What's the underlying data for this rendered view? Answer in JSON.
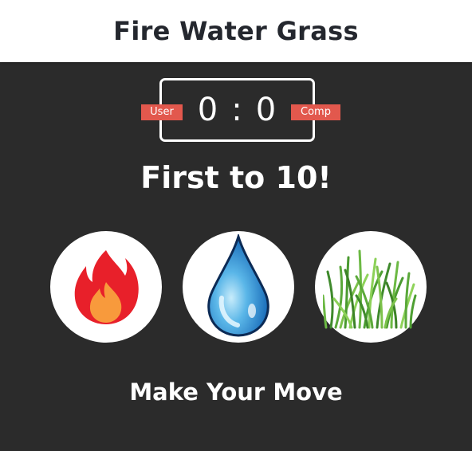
{
  "header": {
    "title": "Fire Water Grass"
  },
  "scoreboard": {
    "user_label": "User",
    "comp_label": "Comp",
    "user_score": "0",
    "separator": ":",
    "comp_score": "0"
  },
  "result": {
    "message": "First to 10!"
  },
  "choices": [
    {
      "name": "fire",
      "icon": "fire-icon"
    },
    {
      "name": "water",
      "icon": "water-drop-icon"
    },
    {
      "name": "grass",
      "icon": "grass-icon"
    }
  ],
  "action": {
    "message": "Make Your Move"
  },
  "colors": {
    "background": "#2b2b2b",
    "header_bg": "#ffffff",
    "header_text": "#24272e",
    "badge": "#e2584d",
    "text": "#ffffff"
  }
}
